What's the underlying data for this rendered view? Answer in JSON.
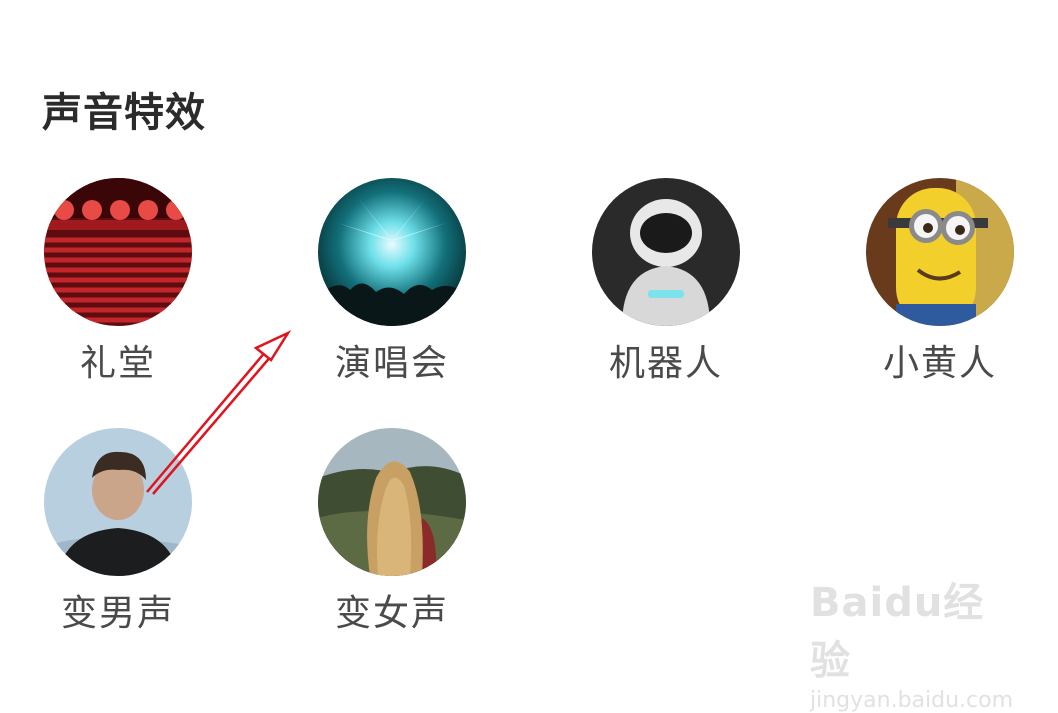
{
  "section": {
    "title": "声音特效"
  },
  "effects": [
    {
      "label": "礼堂",
      "icon": "auditorium-image"
    },
    {
      "label": "演唱会",
      "icon": "concert-image"
    },
    {
      "label": "机器人",
      "icon": "robot-image"
    },
    {
      "label": "小黄人",
      "icon": "minion-image"
    },
    {
      "label": "变男声",
      "icon": "male-voice-image"
    },
    {
      "label": "变女声",
      "icon": "female-voice-image"
    }
  ],
  "annotation": {
    "color": "#e0141e"
  },
  "watermark": {
    "logo": "Baidu经验",
    "url": "jingyan.baidu.com"
  }
}
